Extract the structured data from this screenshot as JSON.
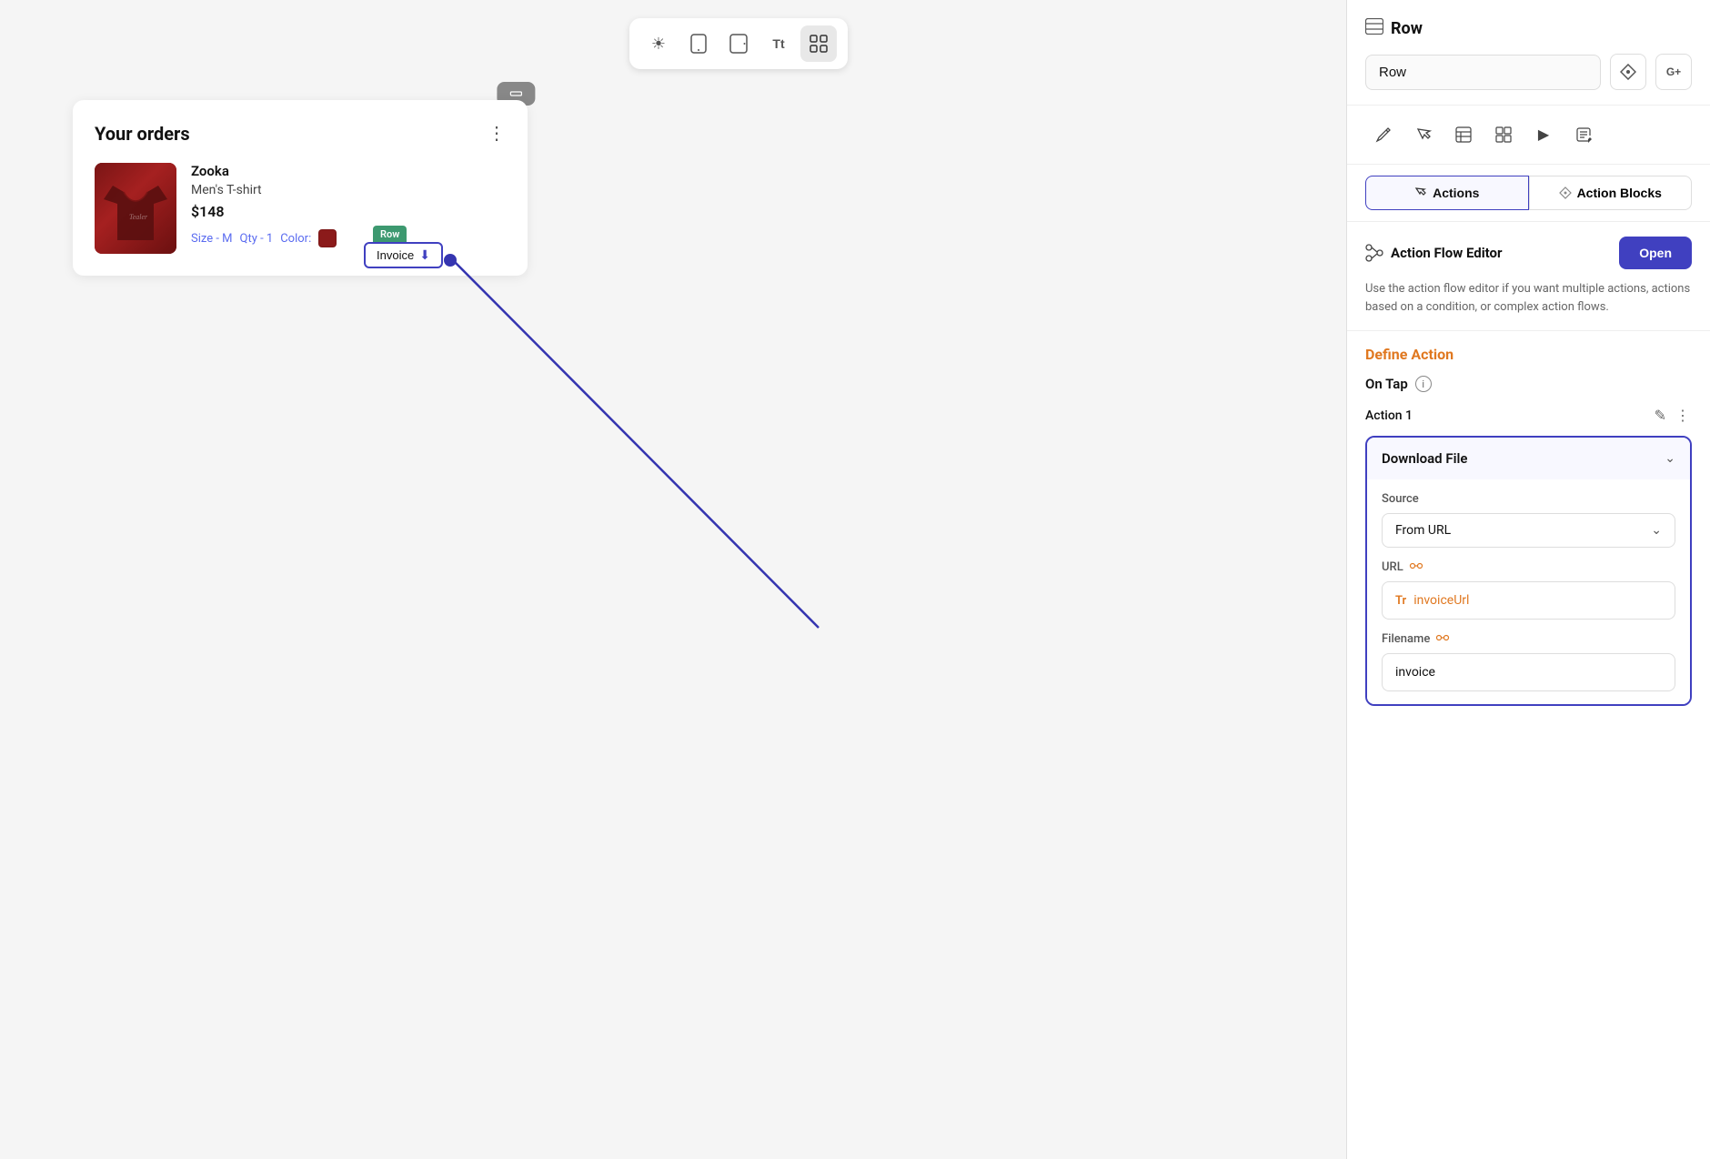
{
  "canvas": {
    "toolbar": {
      "buttons": [
        {
          "id": "sun",
          "icon": "☀",
          "label": "sun-icon",
          "active": false
        },
        {
          "id": "mobile",
          "icon": "📱",
          "label": "mobile-icon",
          "active": false
        },
        {
          "id": "tablet",
          "icon": "⊞",
          "label": "tablet-icon",
          "active": false
        },
        {
          "id": "text-size",
          "icon": "Tt",
          "label": "text-size-icon",
          "active": false
        },
        {
          "id": "grid",
          "icon": "⊞",
          "label": "grid-settings-icon",
          "active": true
        }
      ]
    },
    "component_button": "⊟"
  },
  "orders_card": {
    "title": "Your orders",
    "item": {
      "brand": "Zooka",
      "product": "Men's T-shirt",
      "price": "$148",
      "size_label": "Size - M",
      "qty_label": "Qty - 1",
      "color_label": "Color:"
    },
    "row_tag": "Row",
    "invoice_button": "Invoice"
  },
  "right_panel": {
    "header": {
      "title": "Row",
      "title_icon": "⊞"
    },
    "name_input": {
      "value": "Row",
      "placeholder": "Row"
    },
    "icon_btns": [
      {
        "id": "diamond",
        "icon": "◈"
      },
      {
        "id": "add-char",
        "icon": "G+"
      }
    ],
    "tools": [
      {
        "id": "wrench",
        "icon": "✂",
        "label": "properties-icon"
      },
      {
        "id": "cursor",
        "icon": "↖",
        "label": "interaction-icon"
      },
      {
        "id": "table",
        "icon": "⊟",
        "label": "data-icon"
      },
      {
        "id": "layout",
        "icon": "⊞",
        "label": "layout-icon"
      },
      {
        "id": "play",
        "icon": "▶",
        "label": "play-icon"
      },
      {
        "id": "notes",
        "icon": "📋",
        "label": "notes-icon"
      }
    ],
    "tabs": [
      {
        "id": "actions",
        "label": "Actions",
        "icon": "↖",
        "active": true
      },
      {
        "id": "action-blocks",
        "label": "Action Blocks",
        "icon": "◈",
        "active": false
      }
    ],
    "action_flow_editor": {
      "label": "Action Flow Editor",
      "open_button": "Open",
      "description": "Use the action flow editor if you want multiple actions, actions based on a condition, or complex action flows."
    },
    "define_action": {
      "title": "Define Action",
      "on_tap_label": "On Tap",
      "action_1_label": "Action 1",
      "download_file": {
        "header_label": "Download File",
        "source_label": "Source",
        "source_value": "From URL",
        "url_label": "URL",
        "url_link_icon": "⊞",
        "url_value": "invoiceUrl",
        "filename_label": "Filename",
        "filename_link_icon": "⊞",
        "filename_value": "invoice"
      }
    }
  }
}
